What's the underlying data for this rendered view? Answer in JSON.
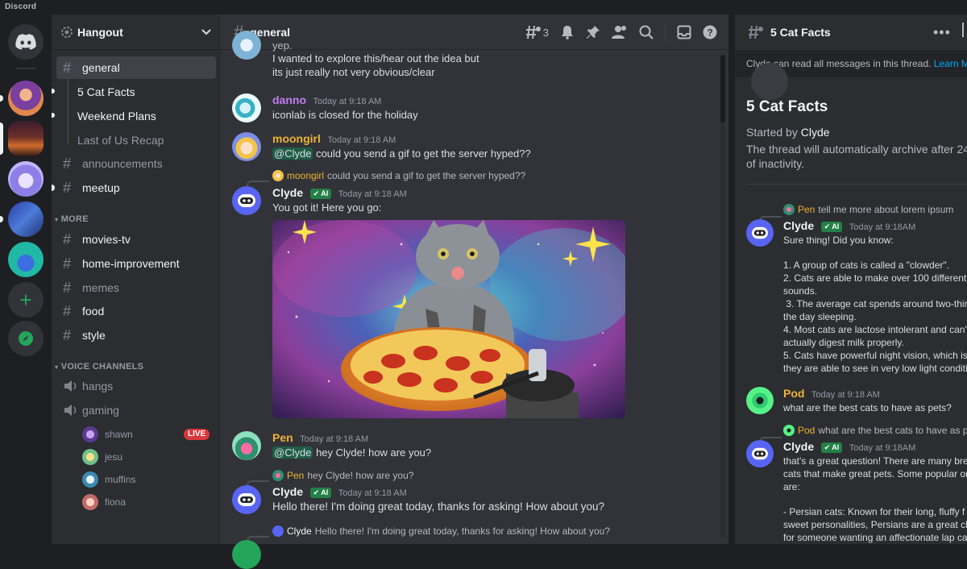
{
  "app": {
    "title": "Discord"
  },
  "server": {
    "name": "Hangout"
  },
  "sidebar": {
    "channels": [
      {
        "label": "general",
        "state": "active"
      },
      {
        "label": "announcements",
        "state": "muted"
      },
      {
        "label": "meetup",
        "state": "unread"
      }
    ],
    "threads": [
      {
        "label": "5 Cat Facts"
      },
      {
        "label": "Weekend Plans"
      },
      {
        "label": "Last of Us Recap"
      }
    ],
    "more_label": "MORE",
    "more_channels": [
      {
        "label": "movies-tv"
      },
      {
        "label": "home-improvement"
      },
      {
        "label": "memes"
      },
      {
        "label": "food"
      },
      {
        "label": "style"
      }
    ],
    "voice_label": "VOICE CHANNELS",
    "voice_channels": [
      {
        "label": "hangs"
      },
      {
        "label": "gaming"
      }
    ],
    "voice_users": [
      {
        "name": "shawn",
        "live": "LIVE"
      },
      {
        "name": "jesu"
      },
      {
        "name": "muffins"
      },
      {
        "name": "fiona"
      }
    ]
  },
  "main": {
    "channel_name": "general",
    "thread_count": "3",
    "messages": {
      "m0": {
        "line1": "yep.",
        "line2": "I wanted to explore this/hear out the idea but",
        "line3": "its just really not very obvious/clear"
      },
      "m1": {
        "user": "danno",
        "time": "Today at 9:18 AM",
        "text": "iconlab is closed for the holiday"
      },
      "m2": {
        "user": "moongirl",
        "time": "Today at 9:18 AM",
        "mention": "@Clyde",
        "text": "could you send a gif to get the server hyped??"
      },
      "m3": {
        "reply_user": "moongirl",
        "reply_text": "could you send a gif to get the server hyped??",
        "user": "Clyde",
        "tag": "AI",
        "time": "Today at 9:18 AM",
        "text": "You got it! Here you go:"
      },
      "m4": {
        "user": "Pen",
        "time": "Today at 9:18 AM",
        "mention": "@Clyde",
        "text": "hey Clyde! how are you?"
      },
      "m5": {
        "reply_user": "Pen",
        "reply_text": "hey Clyde! how are you?",
        "user": "Clyde",
        "tag": "AI",
        "time": "Today at 9:18 AM",
        "text": "Hello there! I'm doing great today, thanks for asking! How about you?"
      },
      "m6": {
        "reply_user": "Clyde",
        "reply_text": "Hello there! I'm doing great today, thanks for asking! How about you?"
      }
    }
  },
  "thread_panel": {
    "name": "5 Cat Facts",
    "banner": "Clyde can read all messages in this thread.",
    "banner_link": "Learn More",
    "title": "5 Cat Facts",
    "started_prefix": "Started by",
    "started_by": "Clyde",
    "archive_line1": "The thread will automatically archive after 24",
    "archive_line2": "of inactivity.",
    "messages": {
      "t1": {
        "reply_user": "Pen",
        "reply_text": "tell me more about lorem ipsum",
        "user": "Clyde",
        "tag": "AI",
        "time": "Today at 9:18AM",
        "lines": [
          "Sure thing! Did you know:",
          "",
          "1. A group of cats is called a \"clowder\".",
          "2. Cats are able to make over 100 different",
          "sounds.",
          " 3. The average cat spends around two-thirds",
          "the day sleeping.",
          "4. Most cats are lactose intolerant and can't",
          "actually digest milk properly.",
          "5. Cats have powerful night vision, which is",
          "they are able to see in very low light conditi"
        ]
      },
      "t2": {
        "user": "Pod",
        "time": "Today at 9:18 AM",
        "text": "what are the best cats to have as pets?"
      },
      "t3": {
        "reply_user": "Pod",
        "reply_text": "what are the best cats to have as pets?",
        "user": "Clyde",
        "tag": "AI",
        "time": "Today at 9:18AM",
        "lines": [
          "that's a great question! There are many bree",
          "cats that make great pets. Some popular on",
          "are:",
          "",
          "- Persian cats: Known for their long, fluffy f",
          "sweet personalities, Persians are a great ch",
          "for someone wanting an affectionate lap ca"
        ]
      }
    }
  },
  "colors": {
    "accent": "#5865f2",
    "clyde_tag": "#248046",
    "live": "#da373c",
    "danno": "#c27cf5",
    "moongirl": "#f0b232",
    "pen": "#f0b232",
    "pod": "#f0b232"
  }
}
